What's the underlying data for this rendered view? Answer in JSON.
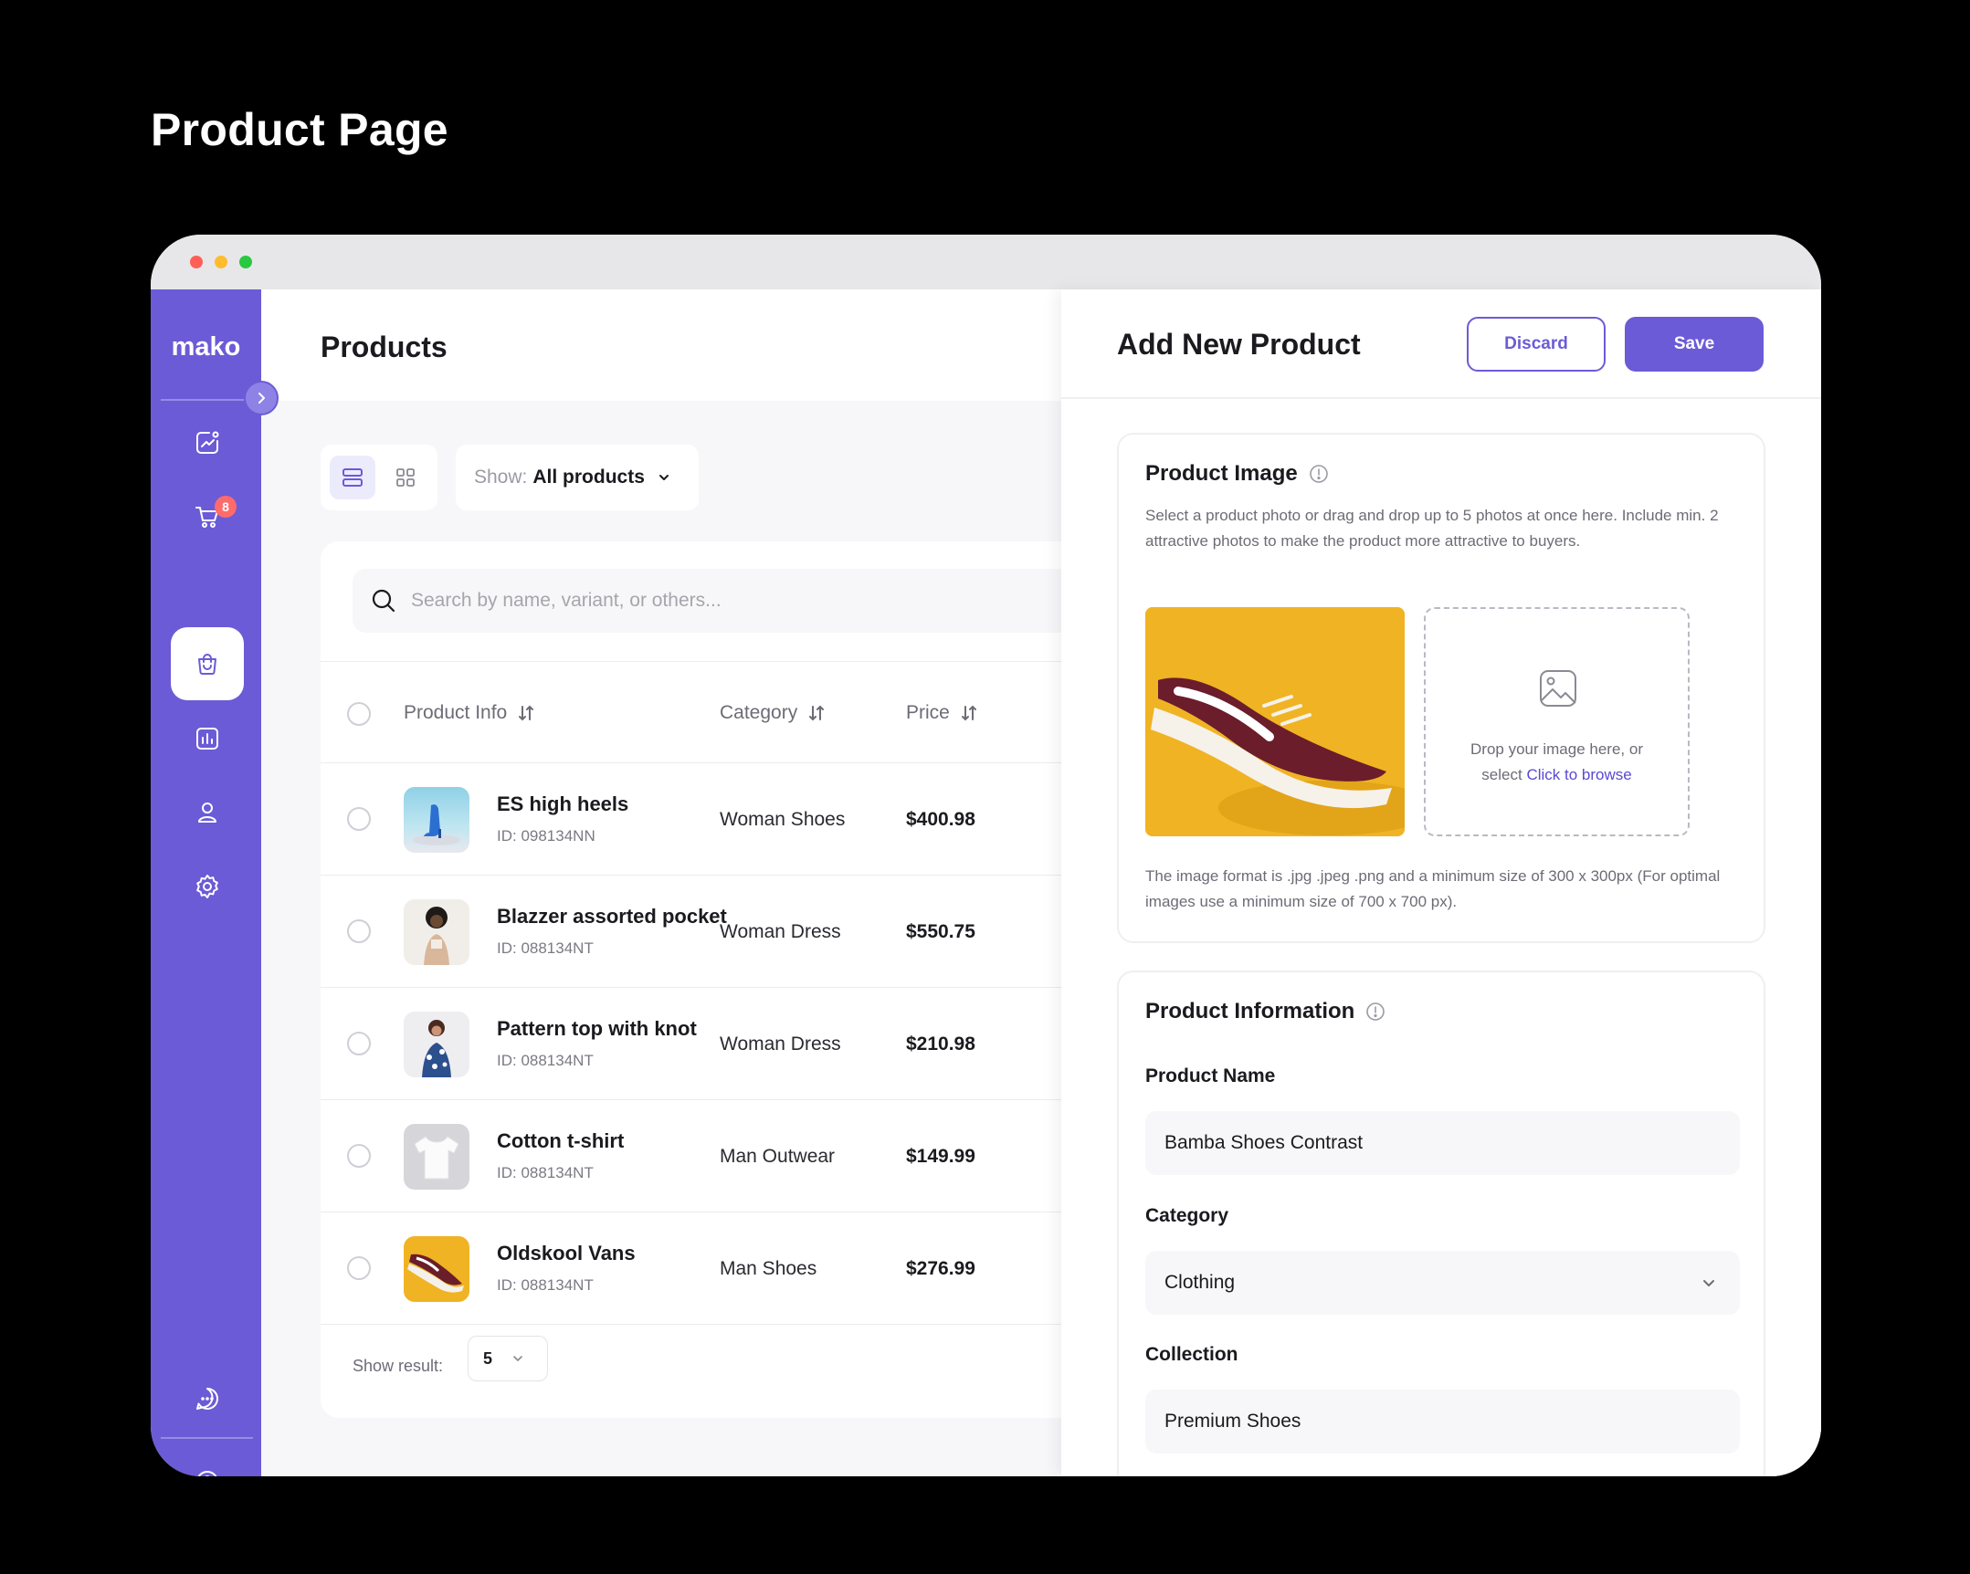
{
  "page_heading": "Product Page",
  "sidebar": {
    "logo": "mako",
    "cart_badge": "8",
    "items": [
      {
        "icon": "analytics-icon"
      },
      {
        "icon": "cart-icon"
      },
      {
        "icon": "shopping-bag-icon"
      },
      {
        "icon": "chart-icon"
      },
      {
        "icon": "user-icon"
      },
      {
        "icon": "gear-icon"
      },
      {
        "icon": "chat-icon"
      },
      {
        "icon": "help-icon"
      }
    ],
    "active_item": "shopping-bag-icon",
    "accent_color": "#6b5bd6"
  },
  "main": {
    "title": "Products",
    "show_label": "Show:",
    "show_value": "All products",
    "search_placeholder": "Search by name, variant, or others...",
    "columns": [
      "Product Info",
      "Category",
      "Price"
    ],
    "rows": [
      {
        "name": "ES high heels",
        "id": "ID: 098134NN",
        "category": "Woman Shoes",
        "price": "$400.98"
      },
      {
        "name": "Blazzer assorted pocket",
        "id": "ID: 088134NT",
        "category": "Woman Dress",
        "price": "$550.75"
      },
      {
        "name": "Pattern top with knot",
        "id": "ID: 088134NT",
        "category": "Woman Dress",
        "price": "$210.98"
      },
      {
        "name": "Cotton t-shirt",
        "id": "ID: 088134NT",
        "category": "Man Outwear",
        "price": "$149.99"
      },
      {
        "name": "Oldskool Vans",
        "id": "ID: 088134NT",
        "category": "Man Shoes",
        "price": "$276.99"
      }
    ],
    "show_result_label": "Show result:",
    "show_result_value": "5"
  },
  "panel": {
    "title": "Add New Product",
    "discard_label": "Discard",
    "save_label": "Save",
    "image_section": {
      "title": "Product Image",
      "description": "Select a product photo or drag and drop up to 5 photos at once here. Include min. 2 attractive photos to make the product more attractive to buyers.",
      "drop_text_1": "Drop your image here, or",
      "drop_text_2": "select",
      "drop_link": "Click to browse",
      "format_note": "The image format is .jpg .jpeg .png and a minimum size of 300 x 300px (For optimal images use a minimum size of 700 x 700 px)."
    },
    "info_section": {
      "title": "Product Information",
      "name_label": "Product Name",
      "name_value": "Bamba Shoes Contrast",
      "category_label": "Category",
      "category_value": "Clothing",
      "collection_label": "Collection",
      "collection_value": "Premium Shoes"
    }
  }
}
